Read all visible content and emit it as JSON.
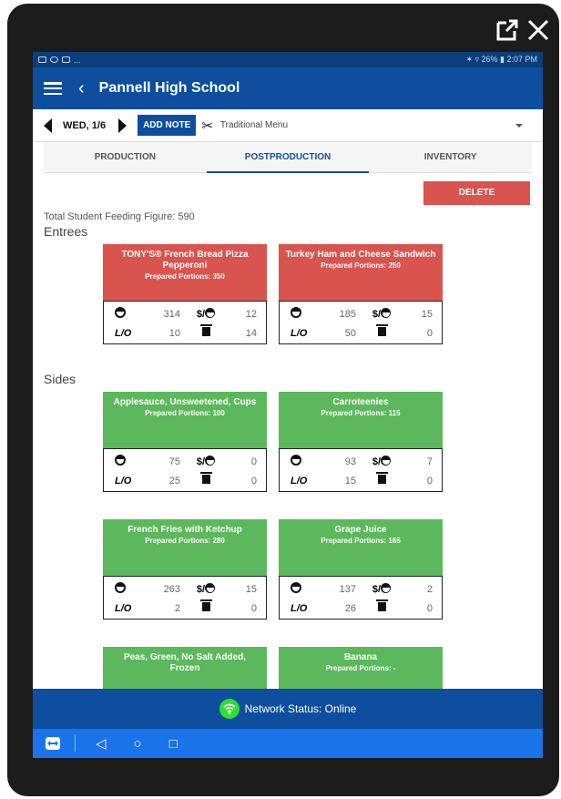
{
  "status_bar": {
    "right": "✶ ▿ 26% ▮ 2:07 PM",
    "left_extra": "..."
  },
  "app_bar": {
    "title": "Pannell High School",
    "back": "‹"
  },
  "date_row": {
    "date": "WED, 1/6",
    "add_note": "ADD NOTE",
    "menu_name": "Traditional Menu"
  },
  "tabs": [
    {
      "label": "PRODUCTION",
      "active": false
    },
    {
      "label": "POSTPRODUCTION",
      "active": true
    },
    {
      "label": "INVENTORY",
      "active": false
    }
  ],
  "delete_label": "DELETE",
  "total_feeding": "Total Student Feeding Figure: 590",
  "sections": {
    "entrees": "Entrees",
    "sides": "Sides"
  },
  "stat_labels": {
    "leftover": "L/O",
    "cost": "$/"
  },
  "entrees": [
    {
      "name": "TONY'S® French Bread Pizza Pepperoni",
      "portions": "Prepared Portions: 350",
      "served": "314",
      "cost": "12",
      "leftover": "10",
      "waste": "14",
      "color": "#d9534f"
    },
    {
      "name": "Turkey Ham and Cheese Sandwich",
      "portions": "Prepared Portions: 250",
      "served": "185",
      "cost": "15",
      "leftover": "50",
      "waste": "0",
      "color": "#d9534f"
    }
  ],
  "sides": [
    {
      "name": "Applesauce, Unsweetened, Cups",
      "portions": "Prepared Portions: 100",
      "served": "75",
      "cost": "0",
      "leftover": "25",
      "waste": "0",
      "color": "#5cb85c"
    },
    {
      "name": "Carroteenies",
      "portions": "Prepared Portions: 115",
      "served": "93",
      "cost": "7",
      "leftover": "15",
      "waste": "0",
      "color": "#5cb85c"
    },
    {
      "name": "French Fries with Ketchup",
      "portions": "Prepared Portions: 280",
      "served": "263",
      "cost": "15",
      "leftover": "2",
      "waste": "0",
      "color": "#5cb85c"
    },
    {
      "name": "Grape Juice",
      "portions": "Prepared Portions: 165",
      "served": "137",
      "cost": "2",
      "leftover": "26",
      "waste": "0",
      "color": "#5cb85c"
    },
    {
      "name": "Peas, Green, No Salt Added, Frozen",
      "portions": "",
      "color": "#5cb85c"
    },
    {
      "name": "Banana",
      "portions": "Prepared Portions: -",
      "color": "#5cb85c"
    }
  ],
  "network": {
    "label": "Network Status: Online"
  },
  "colors": {
    "primary": "#0d4f9e",
    "danger": "#d9534f",
    "success": "#5cb85c",
    "online": "#2ee02e"
  }
}
